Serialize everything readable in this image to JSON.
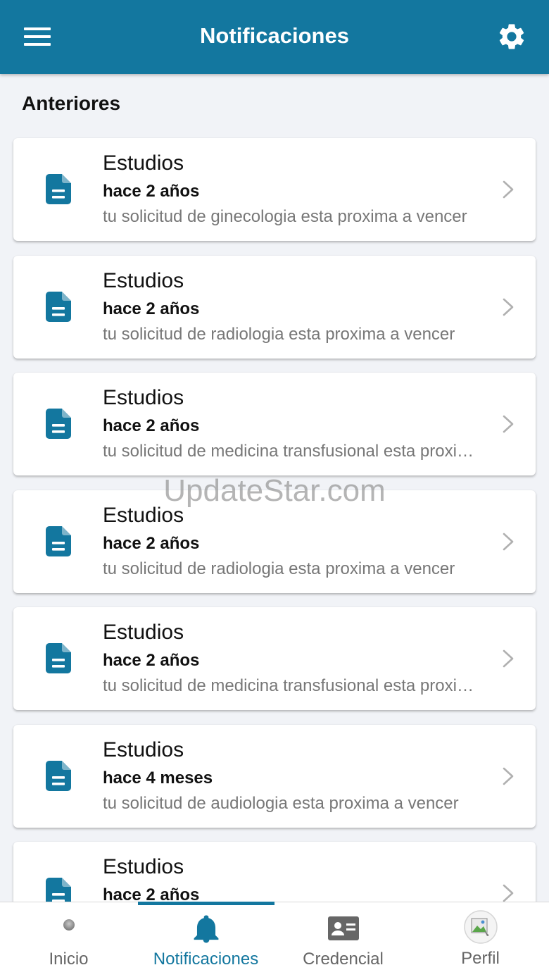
{
  "header": {
    "title": "Notificaciones",
    "menu_icon": "hamburger-menu-icon",
    "settings_icon": "gear-icon"
  },
  "section": {
    "title": "Anteriores"
  },
  "notifications": [
    {
      "title": "Estudios",
      "time": "hace 2 años",
      "message": "tu solicitud de ginecologia esta proxima a vencer"
    },
    {
      "title": "Estudios",
      "time": "hace 2 años",
      "message": "tu solicitud de radiologia esta proxima a vencer"
    },
    {
      "title": "Estudios",
      "time": "hace 2 años",
      "message": "tu solicitud de medicina transfusional esta proxima a vencer"
    },
    {
      "title": "Estudios",
      "time": "hace 2 años",
      "message": "tu solicitud de radiologia esta proxima a vencer"
    },
    {
      "title": "Estudios",
      "time": "hace 2 años",
      "message": "tu solicitud de medicina transfusional esta proxima a vencer"
    },
    {
      "title": "Estudios",
      "time": "hace 4 meses",
      "message": "tu solicitud de audiologia esta proxima a vencer"
    },
    {
      "title": "Estudios",
      "time": "hace 2 años",
      "message": ""
    }
  ],
  "bottom_nav": {
    "items": [
      {
        "label": "Inicio",
        "icon": "home-logo-icon"
      },
      {
        "label": "Notificaciones",
        "icon": "bell-icon"
      },
      {
        "label": "Credencial",
        "icon": "id-card-icon"
      },
      {
        "label": "Perfil",
        "icon": "avatar-icon"
      }
    ],
    "active": "Notificaciones"
  },
  "watermark": "UpdateStar.com",
  "colors": {
    "primary": "#13779f",
    "background": "#f1f3f7",
    "muted_text": "#777777"
  }
}
